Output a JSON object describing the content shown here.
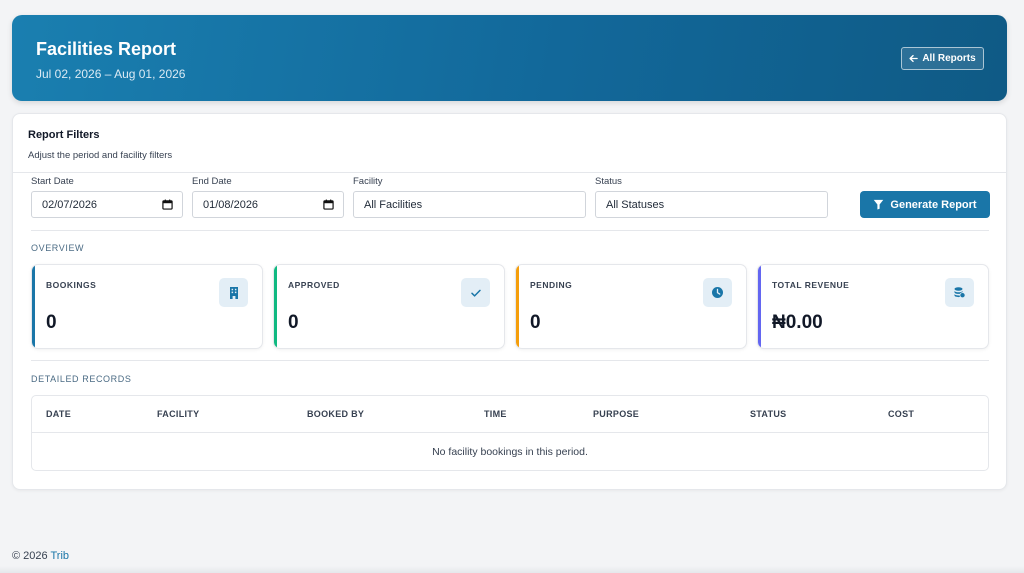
{
  "header": {
    "title": "Facilities Report",
    "date_range": "Jul 02, 2026 – Aug 01, 2026",
    "all_reports_label": "All Reports"
  },
  "filters": {
    "title": "Report Filters",
    "subtitle": "Adjust the period and facility filters",
    "start_date": {
      "label": "Start Date",
      "value": "02/07/2026"
    },
    "end_date": {
      "label": "End Date",
      "value": "01/08/2026"
    },
    "facility": {
      "label": "Facility",
      "value": "All Facilities"
    },
    "status": {
      "label": "Status",
      "value": "All Statuses"
    },
    "generate_label": "Generate Report"
  },
  "overview": {
    "label": "OVERVIEW",
    "stats": [
      {
        "label": "BOOKINGS",
        "value": "0",
        "color": "#1a76a8",
        "icon": "building-icon"
      },
      {
        "label": "APPROVED",
        "value": "0",
        "color": "#10b981",
        "icon": "check-icon"
      },
      {
        "label": "PENDING",
        "value": "0",
        "color": "#f59e0b",
        "icon": "clock-icon"
      },
      {
        "label": "TOTAL REVENUE",
        "value": "₦0.00",
        "color": "#6366f1",
        "icon": "coins-icon"
      }
    ]
  },
  "records": {
    "label": "DETAILED RECORDS",
    "columns": [
      "DATE",
      "FACILITY",
      "BOOKED BY",
      "TIME",
      "PURPOSE",
      "STATUS",
      "COST"
    ],
    "empty_message": "No facility bookings in this period."
  },
  "footer": {
    "copyright": "© 2026",
    "brand": "Trib"
  },
  "colors": {
    "accent": "#1a76a8",
    "icon_bg": "#e3eef6"
  }
}
